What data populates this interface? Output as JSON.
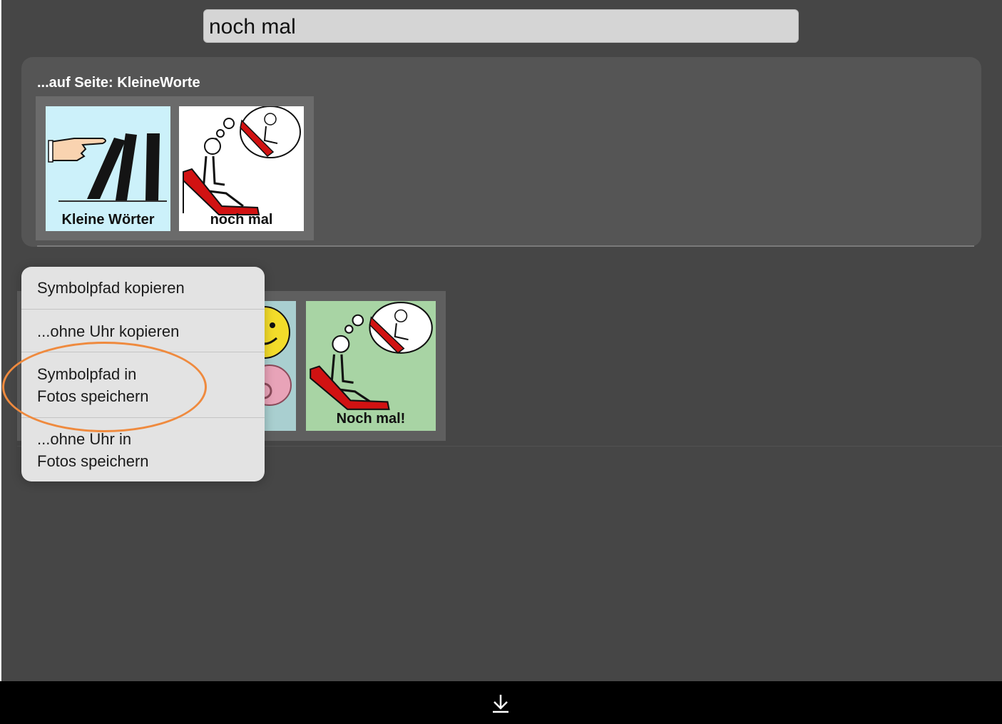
{
  "search": {
    "value": "noch mal"
  },
  "result_panel": {
    "label": "...auf Seite: KleineWorte",
    "tiles": [
      {
        "caption": "Kleine Wörter",
        "icon": "pointing-hand-books-icon",
        "background": "#ccf1fa"
      },
      {
        "caption": "noch mal",
        "icon": "slide-again-icon",
        "background": "#ffffff"
      }
    ]
  },
  "second_row": {
    "tiles": [
      {
        "caption": "",
        "icon": "smiley-pacifier-icon",
        "background": "#a9cfd0"
      },
      {
        "caption": "Noch mal!",
        "icon": "slide-again-icon",
        "background": "#a8d4a4"
      }
    ]
  },
  "context_menu": {
    "items": [
      {
        "label": "Symbolpfad kopieren"
      },
      {
        "label": "...ohne Uhr kopieren"
      },
      {
        "label_line1": "Symbolpfad in",
        "label_line2": "Fotos speichern"
      },
      {
        "label_line1": "...ohne Uhr in",
        "label_line2": "Fotos speichern"
      }
    ]
  },
  "annotation": {
    "color": "#ef8a3e",
    "shape": "ellipse",
    "target": "context_menu.items.2"
  },
  "bottom_bar": {
    "icon": "download-arrow-icon"
  }
}
